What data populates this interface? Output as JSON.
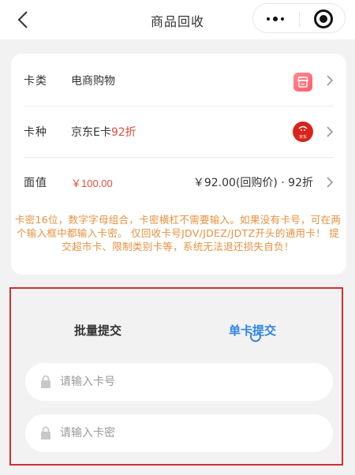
{
  "navbar": {
    "title": "商品回收",
    "back_icon": "chevron-left-icon",
    "more_icon": "more-dots-icon",
    "close_icon": "target-close-icon"
  },
  "card": {
    "category": {
      "label": "卡类",
      "value": "电商购物",
      "icon": "shop-icon"
    },
    "type": {
      "label": "卡种",
      "value": "京东E卡",
      "discount": "92折",
      "icon": "jd-logo-icon",
      "icon_text": "京东"
    },
    "face": {
      "label": "面值",
      "value": "￥100.00",
      "price": "￥92.00(回购价) · 92折"
    }
  },
  "notice": "卡密16位，数字字母组合，卡密横杠不需要输入。如果没有卡号，可在两个输入框中都输入卡密。 仅回收卡号JDV/JDEZ/JDTZ开头的通用卡！ 提交超市卡、限制类别卡等，系统无法退还损失自负！",
  "submit": {
    "tabs": {
      "batch": "批量提交",
      "single": "单卡提交"
    },
    "card_number_placeholder": "请输入卡号",
    "card_password_placeholder": "请输入卡密"
  },
  "colors": {
    "accent_blue": "#2f86e6",
    "price_red": "#e74c3c",
    "notice_orange": "#e8913f",
    "highlight_border": "#d32f2f"
  }
}
